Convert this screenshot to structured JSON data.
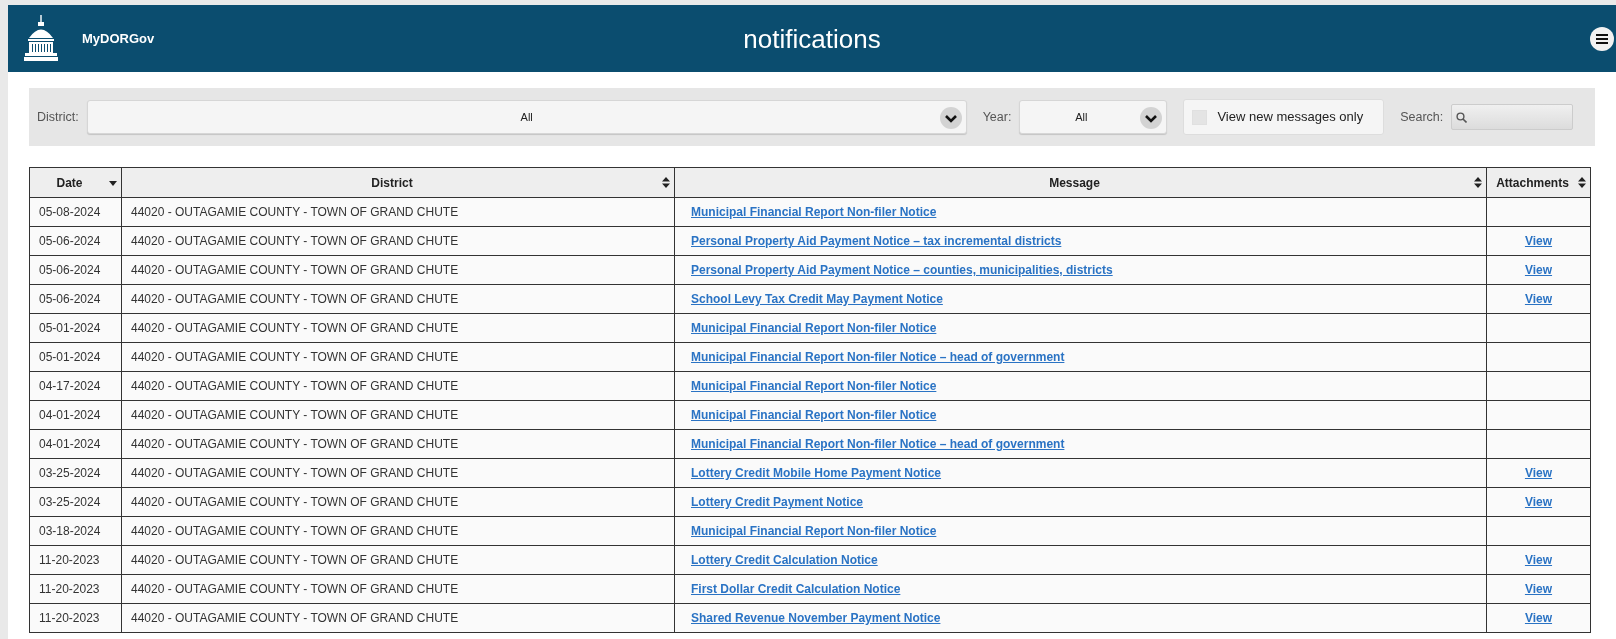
{
  "header": {
    "brand": "MyDORGov",
    "title": "notifications"
  },
  "filters": {
    "district_label": "District:",
    "district_value": "All",
    "year_label": "Year:",
    "year_value": "All",
    "new_only": {
      "label": "View new messages only",
      "checked": false
    },
    "search_label": "Search:"
  },
  "table": {
    "columns": [
      {
        "label": "Date",
        "sorted": true
      },
      {
        "label": "District",
        "sorted": false
      },
      {
        "label": "Message",
        "sorted": false
      },
      {
        "label": "Attachments",
        "sorted": false
      }
    ],
    "rows": [
      {
        "date": "05-08-2024",
        "district": "44020 - OUTAGAMIE COUNTY - TOWN OF GRAND CHUTE",
        "message": "Municipal Financial Report Non-filer Notice"
      },
      {
        "date": "05-06-2024",
        "district": "44020 - OUTAGAMIE COUNTY - TOWN OF GRAND CHUTE",
        "message": "Personal Property Aid Payment Notice – tax incremental districts",
        "attachment": "View"
      },
      {
        "date": "05-06-2024",
        "district": "44020 - OUTAGAMIE COUNTY - TOWN OF GRAND CHUTE",
        "message": "Personal Property Aid Payment Notice – counties, municipalities, districts",
        "attachment": "View"
      },
      {
        "date": "05-06-2024",
        "district": "44020 - OUTAGAMIE COUNTY - TOWN OF GRAND CHUTE",
        "message": "School Levy Tax Credit May Payment Notice",
        "attachment": "View"
      },
      {
        "date": "05-01-2024",
        "district": "44020 - OUTAGAMIE COUNTY - TOWN OF GRAND CHUTE",
        "message": "Municipal Financial Report Non-filer Notice"
      },
      {
        "date": "05-01-2024",
        "district": "44020 - OUTAGAMIE COUNTY - TOWN OF GRAND CHUTE",
        "message": "Municipal Financial Report Non-filer Notice – head of government"
      },
      {
        "date": "04-17-2024",
        "district": "44020 - OUTAGAMIE COUNTY - TOWN OF GRAND CHUTE",
        "message": "Municipal Financial Report Non-filer Notice"
      },
      {
        "date": "04-01-2024",
        "district": "44020 - OUTAGAMIE COUNTY - TOWN OF GRAND CHUTE",
        "message": "Municipal Financial Report Non-filer Notice"
      },
      {
        "date": "04-01-2024",
        "district": "44020 - OUTAGAMIE COUNTY - TOWN OF GRAND CHUTE",
        "message": "Municipal Financial Report Non-filer Notice – head of government"
      },
      {
        "date": "03-25-2024",
        "district": "44020 - OUTAGAMIE COUNTY - TOWN OF GRAND CHUTE",
        "message": "Lottery Credit Mobile Home Payment Notice",
        "attachment": "View"
      },
      {
        "date": "03-25-2024",
        "district": "44020 - OUTAGAMIE COUNTY - TOWN OF GRAND CHUTE",
        "message": "Lottery Credit Payment Notice",
        "attachment": "View"
      },
      {
        "date": "03-18-2024",
        "district": "44020 - OUTAGAMIE COUNTY - TOWN OF GRAND CHUTE",
        "message": "Municipal Financial Report Non-filer Notice"
      },
      {
        "date": "11-20-2023",
        "district": "44020 - OUTAGAMIE COUNTY - TOWN OF GRAND CHUTE",
        "message": "Lottery Credit Calculation Notice",
        "attachment": "View"
      },
      {
        "date": "11-20-2023",
        "district": "44020 - OUTAGAMIE COUNTY - TOWN OF GRAND CHUTE",
        "message": "First Dollar Credit Calculation Notice",
        "attachment": "View"
      },
      {
        "date": "11-20-2023",
        "district": "44020 - OUTAGAMIE COUNTY - TOWN OF GRAND CHUTE",
        "message": "Shared Revenue November Payment Notice",
        "attachment": "View"
      }
    ]
  }
}
